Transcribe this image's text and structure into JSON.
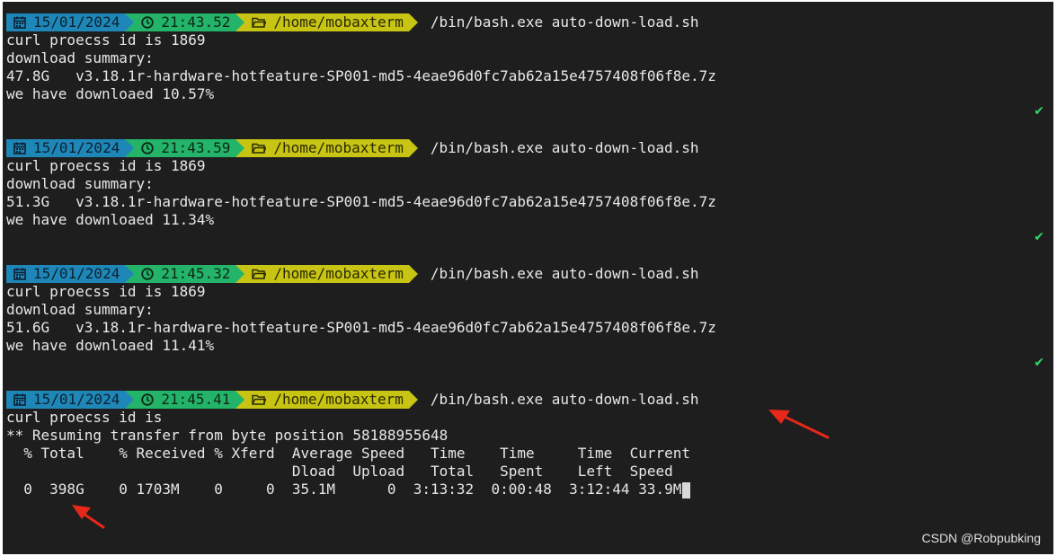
{
  "blocks": [
    {
      "date": "15/01/2024",
      "time": "21:43.52",
      "path": "/home/mobaxterm",
      "command": "/bin/bash.exe auto-down-load.sh",
      "output": [
        "curl proecss id is 1869",
        "download summary:",
        "47.8G   v3.18.1r-hardware-hotfeature-SP001-md5-4eae96d0fc7ab62a15e4757408f06f8e.7z",
        "we have downloaed 10.57%"
      ],
      "status": "✔"
    },
    {
      "date": "15/01/2024",
      "time": "21:43.59",
      "path": "/home/mobaxterm",
      "command": "/bin/bash.exe auto-down-load.sh",
      "output": [
        "curl proecss id is 1869",
        "download summary:",
        "51.3G   v3.18.1r-hardware-hotfeature-SP001-md5-4eae96d0fc7ab62a15e4757408f06f8e.7z",
        "we have downloaed 11.34%"
      ],
      "status": "✔"
    },
    {
      "date": "15/01/2024",
      "time": "21:45.32",
      "path": "/home/mobaxterm",
      "command": "/bin/bash.exe auto-down-load.sh",
      "output": [
        "curl proecss id is 1869",
        "download summary:",
        "51.6G   v3.18.1r-hardware-hotfeature-SP001-md5-4eae96d0fc7ab62a15e4757408f06f8e.7z",
        "we have downloaed 11.41%"
      ],
      "status": "✔"
    },
    {
      "date": "15/01/2024",
      "time": "21:45.41",
      "path": "/home/mobaxterm",
      "command": "/bin/bash.exe auto-down-load.sh",
      "output": [
        "curl proecss id is",
        "** Resuming transfer from byte position 58188955648",
        "  % Total    % Received % Xferd  Average Speed   Time    Time     Time  Current",
        "                                 Dload  Upload   Total   Spent    Left  Speed",
        "  0  398G    0 1703M    0     0  35.1M      0  3:13:32  0:00:48  3:12:44 33.9M"
      ]
    }
  ],
  "watermark": "CSDN @Robpubking",
  "icons": {
    "date": "calendar-icon",
    "time": "clock-icon",
    "path": "folder-icon",
    "annotation": "red-arrow-icon"
  },
  "colors": {
    "background": "#1e1e1e",
    "date_segment": "#1f86b8",
    "time_segment": "#23b46a",
    "path_segment": "#c7c413",
    "check": "#35d46a",
    "annotation_arrow": "#e8281a"
  }
}
